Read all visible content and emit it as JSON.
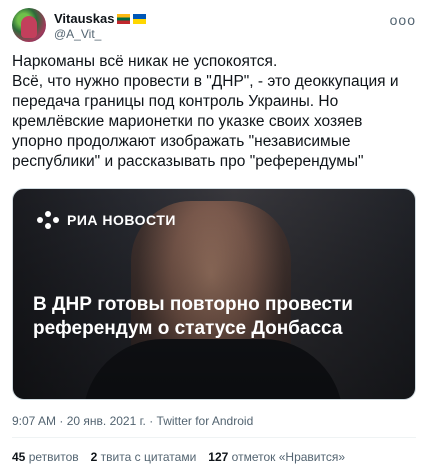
{
  "author": {
    "name": "Vitauskas",
    "handle": "@A_Vit_",
    "flags": [
      "lithuania-flag-icon",
      "ukraine-flag-icon"
    ]
  },
  "more_label": "ooo",
  "tweet_text": "Наркоманы всё никак не успокоятся.\nВсё, что нужно провести в \"ДНР\", - это деоккупация и передача границы под контроль Украины. Но кремлёвские марионетки по указке своих хозяев упорно продолжают изображать \"независимые республики\" и рассказывать про \"референдумы\"",
  "media": {
    "logo_text": "РИА НОВОСТИ",
    "headline": "В ДНР готовы повторно провести\nреферендум о статусе Донбасса"
  },
  "meta": {
    "time": "9:07 AM",
    "date": "20 янв. 2021 г.",
    "source": "Twitter for Android"
  },
  "stats": {
    "retweets_count": "45",
    "retweets_label": "ретвитов",
    "quotes_count": "2",
    "quotes_label": "твита с цитатами",
    "likes_count": "127",
    "likes_label": "отметок «Нравится»"
  }
}
